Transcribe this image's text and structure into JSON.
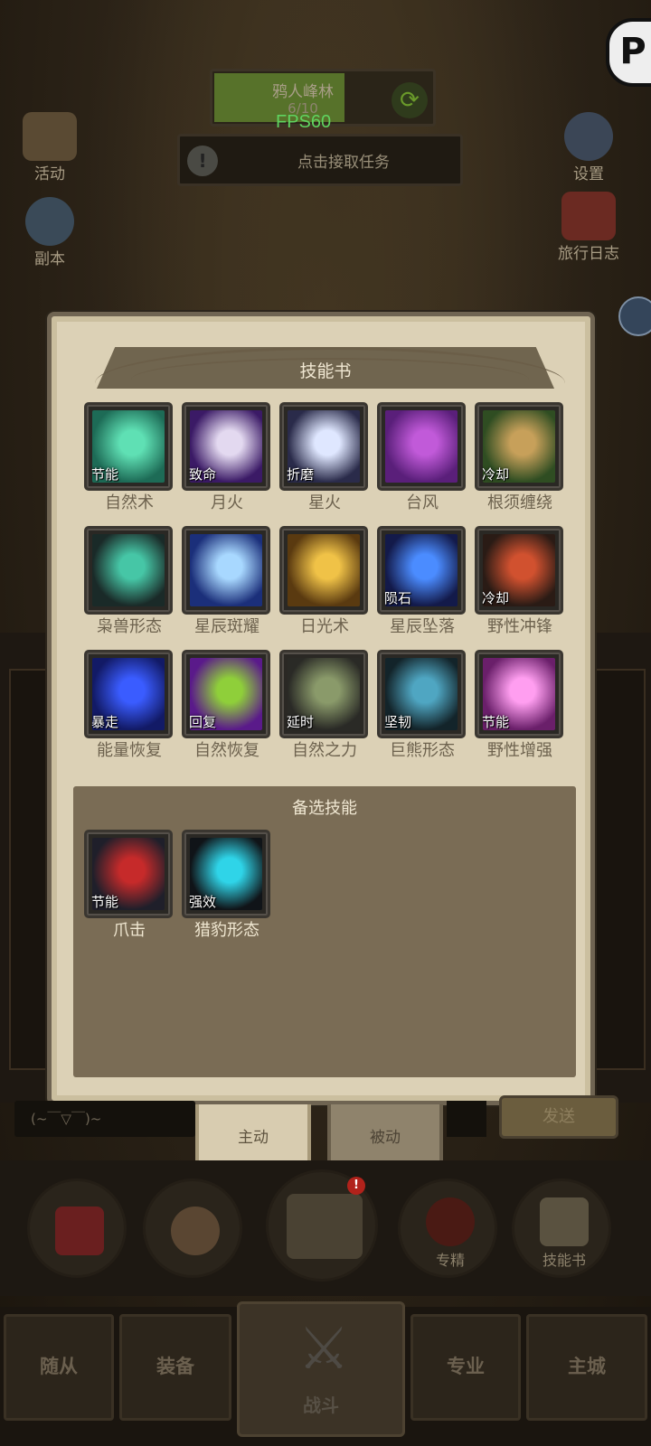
{
  "hud": {
    "zone_name": "鸦人峰林",
    "zone_progress": "6/10",
    "fps": "FPS60",
    "quest_text": "点击接取任务",
    "left_icons": [
      {
        "label": "活动",
        "icon": "activity-icon"
      },
      {
        "label": "副本",
        "icon": "dungeon-icon"
      }
    ],
    "right_icons": [
      {
        "label": "设置",
        "icon": "gear-icon"
      },
      {
        "label": "旅行日志",
        "icon": "travel-log-icon"
      }
    ]
  },
  "dialog": {
    "title": "技能书",
    "skills": [
      {
        "name": "自然术",
        "tag": "节能",
        "colors": [
          "#1d6b56",
          "#5fe0b4"
        ]
      },
      {
        "name": "月火",
        "tag": "致命",
        "colors": [
          "#3b1a66",
          "#e3d9f0"
        ]
      },
      {
        "name": "星火",
        "tag": "折磨",
        "colors": [
          "#2a2b4a",
          "#dfe7ff"
        ]
      },
      {
        "name": "台风",
        "tag": "",
        "colors": [
          "#5a1f7a",
          "#c15ad9"
        ]
      },
      {
        "name": "根须缠绕",
        "tag": "冷却",
        "colors": [
          "#2f4d22",
          "#c7a05a"
        ]
      },
      {
        "name": "枭兽形态",
        "tag": "",
        "colors": [
          "#1a2a28",
          "#46c6a6"
        ]
      },
      {
        "name": "星辰斑耀",
        "tag": "",
        "colors": [
          "#1b2f7a",
          "#a8d8ff"
        ]
      },
      {
        "name": "日光术",
        "tag": "",
        "colors": [
          "#5a3a10",
          "#f0c247"
        ]
      },
      {
        "name": "星辰坠落",
        "tag": "陨石",
        "colors": [
          "#131a4a",
          "#4b8cff"
        ]
      },
      {
        "name": "野性冲锋",
        "tag": "冷却",
        "colors": [
          "#2a1b15",
          "#d1512f"
        ]
      },
      {
        "name": "能量恢复",
        "tag": "暴走",
        "colors": [
          "#121a66",
          "#3a5cff"
        ]
      },
      {
        "name": "自然恢复",
        "tag": "回复",
        "colors": [
          "#5a1a8a",
          "#8fcf3a"
        ]
      },
      {
        "name": "自然之力",
        "tag": "延时",
        "colors": [
          "#2a2a26",
          "#8a9a6a"
        ]
      },
      {
        "name": "巨熊形态",
        "tag": "坚韧",
        "colors": [
          "#13242a",
          "#4fa6c2"
        ]
      },
      {
        "name": "野性增强",
        "tag": "节能",
        "colors": [
          "#6a1f6a",
          "#ff9ef0"
        ]
      }
    ],
    "alt_title": "备选技能",
    "alt_skills": [
      {
        "name": "爪击",
        "tag": "节能",
        "colors": [
          "#1f1f2a",
          "#c62a2a"
        ]
      },
      {
        "name": "猎豹形态",
        "tag": "强效",
        "colors": [
          "#101418",
          "#2fd4e8"
        ]
      }
    ]
  },
  "tabs": {
    "active": "主动",
    "passive": "被动"
  },
  "chat": {
    "placeholder": "(~￣▽￣)~",
    "send": "发送"
  },
  "actions": [
    {
      "label": "",
      "icon": "potion-icon"
    },
    {
      "label": "",
      "icon": "bread-icon"
    },
    {
      "label": "",
      "icon": "treasure-chest-icon"
    },
    {
      "label": "专精",
      "icon": "specialization-icon"
    },
    {
      "label": "技能书",
      "icon": "skill-book-icon"
    }
  ],
  "action_badge": "!",
  "nav": {
    "followers": "随从",
    "equipment": "装备",
    "battle": "战斗",
    "profession": "专业",
    "main_city": "主城"
  }
}
